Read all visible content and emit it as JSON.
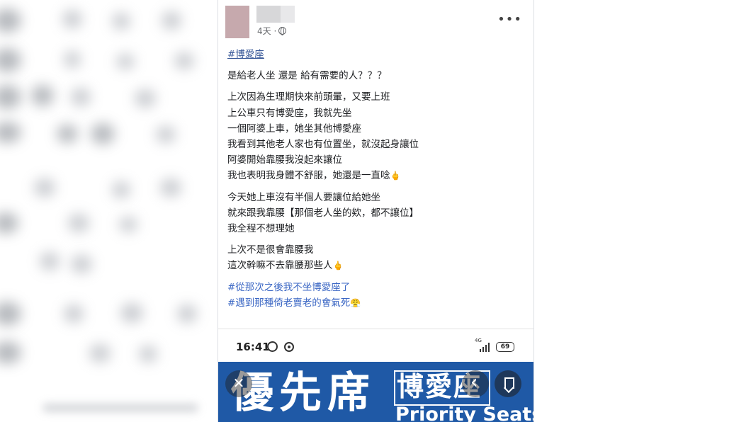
{
  "post": {
    "timestamp": "4天 ·",
    "hashtag_top": "#博愛座",
    "question": "是給老人坐 還是 給有需要的人？？？",
    "para1": [
      "上次因為生理期快來前頭暈，又要上班",
      "上公車只有博愛座，我就先坐",
      "一個阿婆上車，她坐其他博愛座",
      "我看到其他老人家也有位置坐，就沒起身讓位",
      "阿婆開始靠腰我沒起來讓位",
      "我也表明我身體不舒服，她還是一直唸"
    ],
    "para2": [
      "今天她上車沒有半個人要讓位給她坐",
      "就來跟我靠腰【那個老人坐的欸，都不讓位】",
      "我全程不想理她"
    ],
    "para3": [
      "上次不是很會靠腰我",
      "這次幹嘛不去靠腰那些人"
    ],
    "hashtags_bottom": [
      "#從那次之後我不坐博愛座了",
      "#遇到那種倚老賣老的會氣死"
    ],
    "emoji_finger": "🖕",
    "emoji_angry": "😤"
  },
  "photo": {
    "clock": "16:41",
    "network": "4G",
    "battery": "69",
    "banner_big": "優先席",
    "banner_small": "博愛座",
    "banner_en": "Priority Seats",
    "close_label": "✕"
  },
  "icons": {
    "more": "more-horizontal-icon",
    "globe": "globe-icon",
    "alarm": "alarm-icon",
    "chrome": "chrome-icon",
    "signal": "signal-icon",
    "battery": "battery-icon",
    "share": "share-icon",
    "bookmark": "bookmark-icon"
  }
}
